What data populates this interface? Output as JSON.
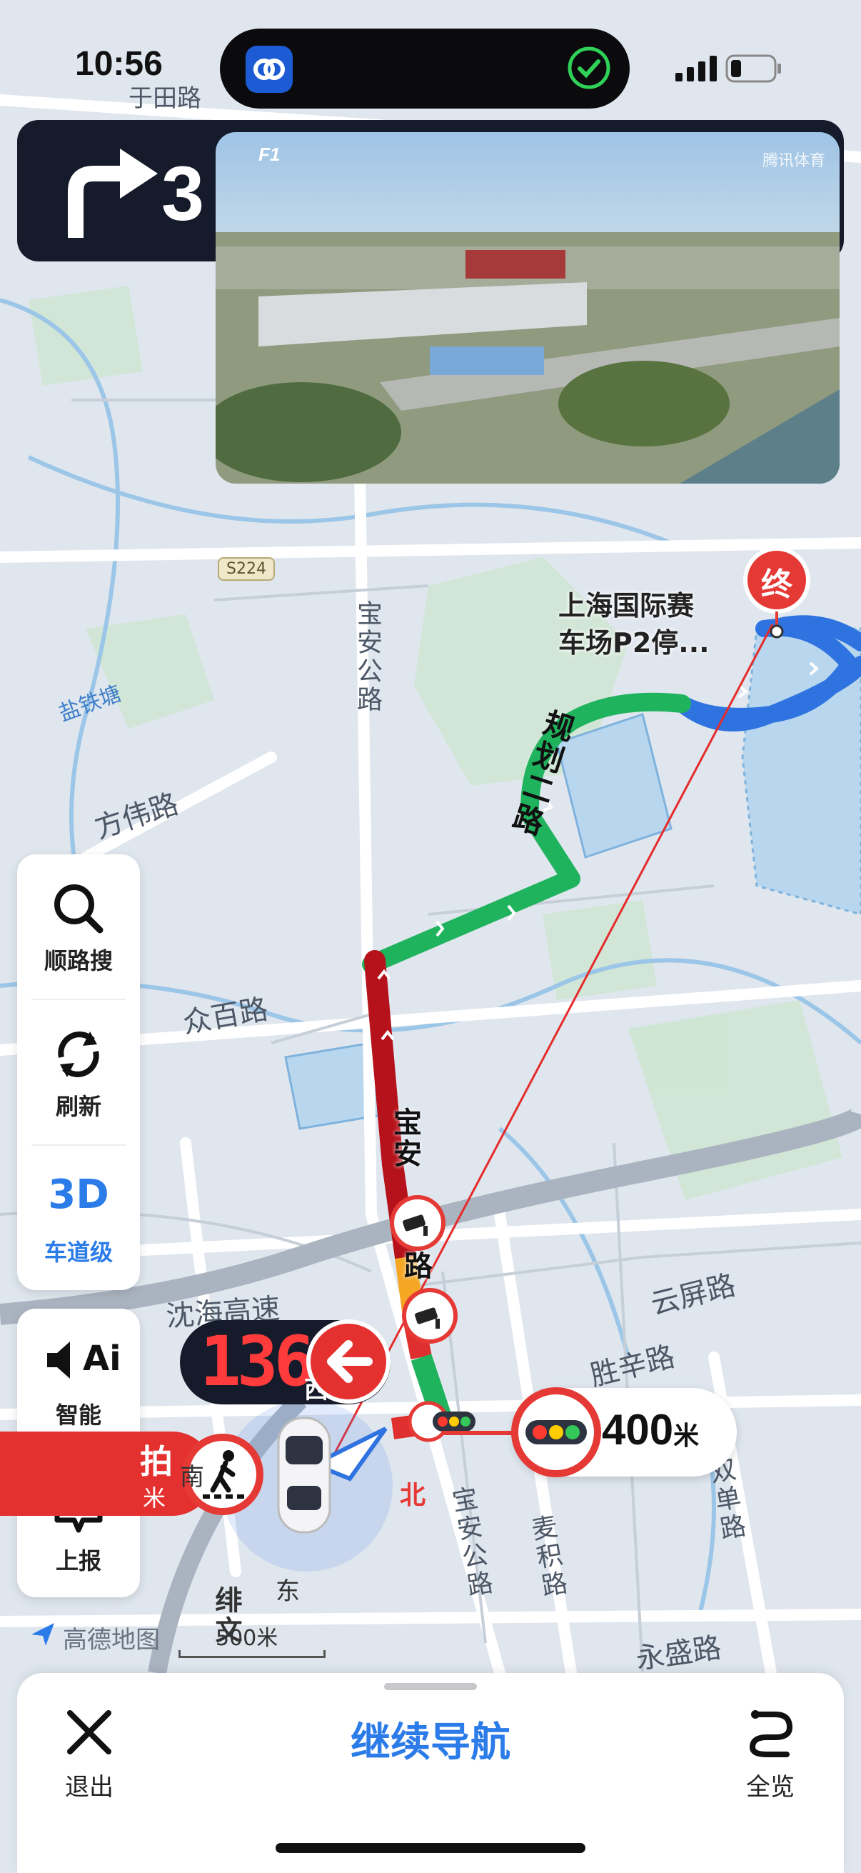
{
  "status_bar": {
    "time": "10:56"
  },
  "turn_instruction": {
    "distance_partial": "3"
  },
  "video_overlay": {
    "watermark": "腾讯体育"
  },
  "map_labels": {
    "yutian_road": "于田路",
    "s224": "S224",
    "yantie": "盐铁塘",
    "fangwei_road": "方伟路",
    "baoan_highway_top": "宝安公路",
    "guihua_road": "规划二路",
    "zhongbai_road": "众百路",
    "yunping_road": "云屏路",
    "shenghai_expressway": "沈海高速",
    "shengxin_road": "胜辛路",
    "shuangdan_road": "双单路",
    "baoan_highway_bottom": "宝安公路",
    "maiji_road": "麦积路",
    "yongsheng_road": "永盛路",
    "baoan_route": "宝安",
    "route_road": "路",
    "pai_partial": "拍",
    "mi_partial": "米",
    "feiwen": "绯文"
  },
  "destination": {
    "marker": "终",
    "name_line1": "上海国际赛",
    "name_line2": "车场P2停..."
  },
  "side_panel": {
    "search_label": "顺路搜",
    "refresh_label": "刷新",
    "lane_3d": "3D",
    "lane_label": "车道级",
    "ai_icon_text": "Ai",
    "ai_label": "智能",
    "report_label": "上报"
  },
  "speed_display": {
    "value": "136",
    "direction": "西"
  },
  "traffic_light": {
    "distance": "400",
    "unit": "米"
  },
  "compass": {
    "north": "北",
    "south": "南",
    "east": "东"
  },
  "map_footer": {
    "logo": "高德地图",
    "scale": "500米"
  },
  "bottom_bar": {
    "exit_label": "退出",
    "continue_label": "继续导航",
    "overview_label": "全览"
  }
}
